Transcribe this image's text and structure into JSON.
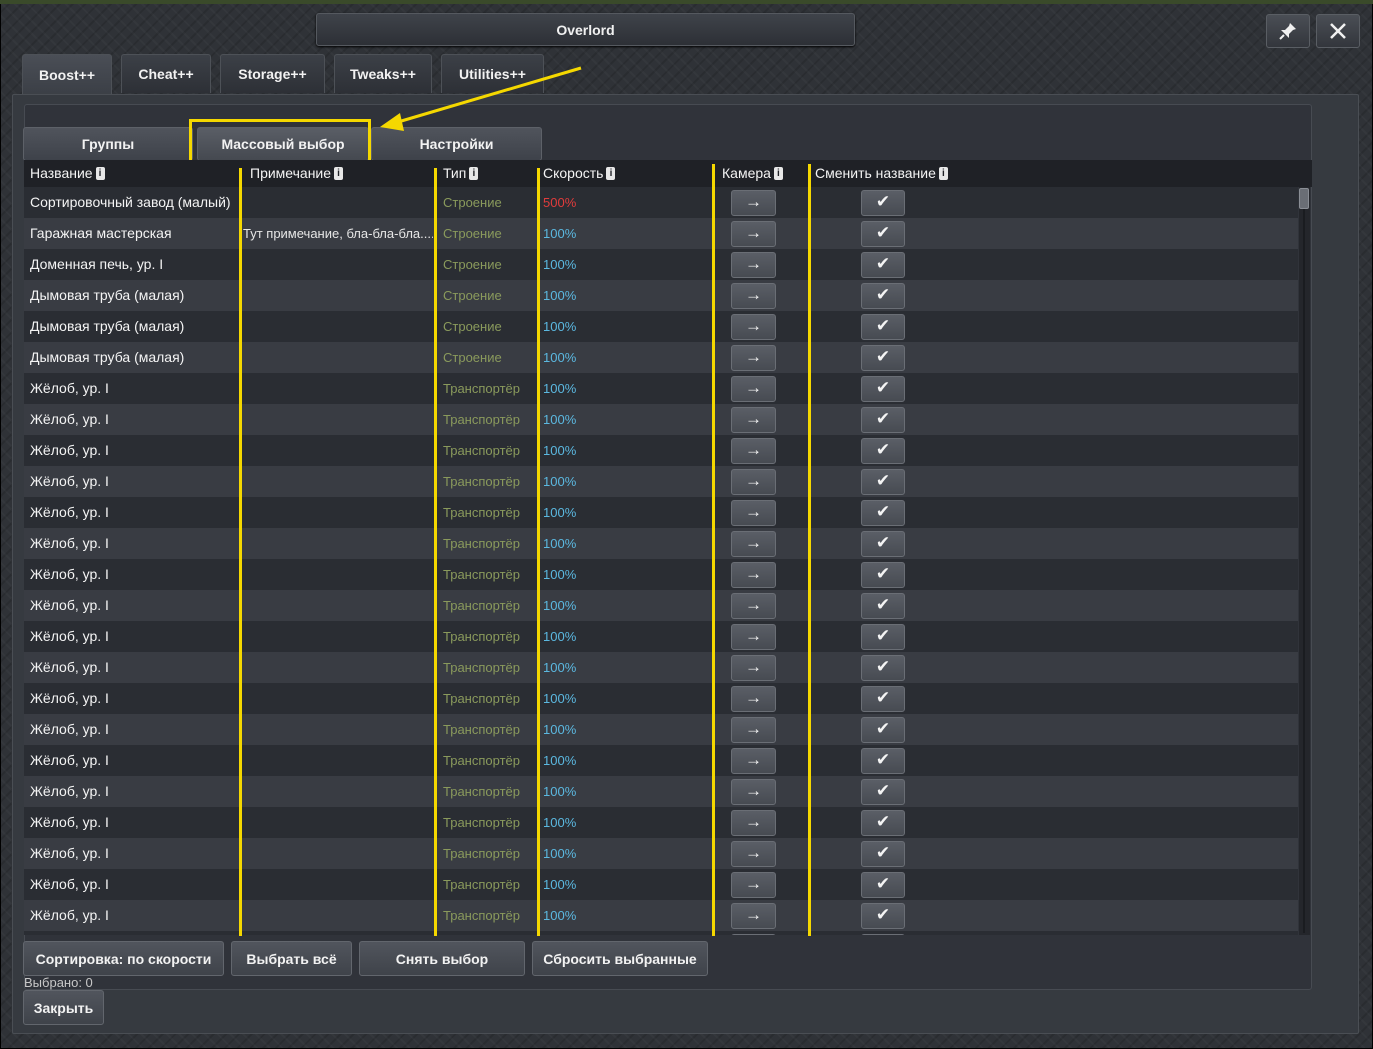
{
  "window": {
    "title": "Overlord",
    "pin_icon": "pin-icon",
    "close_icon": "close-icon"
  },
  "tabs": [
    {
      "label": "Boost++",
      "active": true
    },
    {
      "label": "Cheat++",
      "active": false
    },
    {
      "label": "Storage++",
      "active": false
    },
    {
      "label": "Tweaks++",
      "active": false
    },
    {
      "label": "Utilities++",
      "active": false
    }
  ],
  "subtabs": [
    {
      "label": "Группы",
      "active": false
    },
    {
      "label": "Массовый выбор",
      "active": true
    },
    {
      "label": "Настройки",
      "active": false
    }
  ],
  "columns": {
    "name": "Название",
    "note": "Примечание",
    "type": "Тип",
    "speed": "Скорость",
    "camera": "Камера",
    "rename": "Сменить название"
  },
  "rows": [
    {
      "name": "Сортировочный завод (малый)",
      "note": "",
      "type": "Строение",
      "speed": "500%",
      "speed_color": "#e03c3c"
    },
    {
      "name": "Гаражная мастерская",
      "note": "Тут примечание, бла-бла-бла....",
      "type": "Строение",
      "speed": "100%"
    },
    {
      "name": "Доменная печь, ур. I",
      "note": "",
      "type": "Строение",
      "speed": "100%"
    },
    {
      "name": "Дымовая труба (малая)",
      "note": "",
      "type": "Строение",
      "speed": "100%"
    },
    {
      "name": "Дымовая труба (малая)",
      "note": "",
      "type": "Строение",
      "speed": "100%"
    },
    {
      "name": "Дымовая труба (малая)",
      "note": "",
      "type": "Строение",
      "speed": "100%"
    },
    {
      "name": "Жёлоб, ур. I",
      "note": "",
      "type": "Транспортёр",
      "speed": "100%"
    },
    {
      "name": "Жёлоб, ур. I",
      "note": "",
      "type": "Транспортёр",
      "speed": "100%"
    },
    {
      "name": "Жёлоб, ур. I",
      "note": "",
      "type": "Транспортёр",
      "speed": "100%"
    },
    {
      "name": "Жёлоб, ур. I",
      "note": "",
      "type": "Транспортёр",
      "speed": "100%"
    },
    {
      "name": "Жёлоб, ур. I",
      "note": "",
      "type": "Транспортёр",
      "speed": "100%"
    },
    {
      "name": "Жёлоб, ур. I",
      "note": "",
      "type": "Транспортёр",
      "speed": "100%"
    },
    {
      "name": "Жёлоб, ур. I",
      "note": "",
      "type": "Транспортёр",
      "speed": "100%"
    },
    {
      "name": "Жёлоб, ур. I",
      "note": "",
      "type": "Транспортёр",
      "speed": "100%"
    },
    {
      "name": "Жёлоб, ур. I",
      "note": "",
      "type": "Транспортёр",
      "speed": "100%"
    },
    {
      "name": "Жёлоб, ур. I",
      "note": "",
      "type": "Транспортёр",
      "speed": "100%"
    },
    {
      "name": "Жёлоб, ур. I",
      "note": "",
      "type": "Транспортёр",
      "speed": "100%"
    },
    {
      "name": "Жёлоб, ур. I",
      "note": "",
      "type": "Транспортёр",
      "speed": "100%"
    },
    {
      "name": "Жёлоб, ур. I",
      "note": "",
      "type": "Транспортёр",
      "speed": "100%"
    },
    {
      "name": "Жёлоб, ур. I",
      "note": "",
      "type": "Транспортёр",
      "speed": "100%"
    },
    {
      "name": "Жёлоб, ур. I",
      "note": "",
      "type": "Транспортёр",
      "speed": "100%"
    },
    {
      "name": "Жёлоб, ур. I",
      "note": "",
      "type": "Транспортёр",
      "speed": "100%"
    },
    {
      "name": "Жёлоб, ур. I",
      "note": "",
      "type": "Транспортёр",
      "speed": "100%"
    },
    {
      "name": "Жёлоб, ур. I",
      "note": "",
      "type": "Транспортёр",
      "speed": "100%"
    }
  ],
  "row_buttons": {
    "camera_glyph": "→",
    "rename_glyph": "✔"
  },
  "bottom_buttons": {
    "sort": "Сортировка: по скорости",
    "select_all": "Выбрать всё",
    "deselect": "Снять выбор",
    "reset_selected": "Сбросить выбранные"
  },
  "selected_count": "Выбрано: 0",
  "close_label": "Закрыть",
  "colors": {
    "annotation": "#f5d800",
    "speed_default": "#5bb8e0",
    "speed_boosted": "#e03c3c",
    "type_text": "#8a9a5c"
  }
}
